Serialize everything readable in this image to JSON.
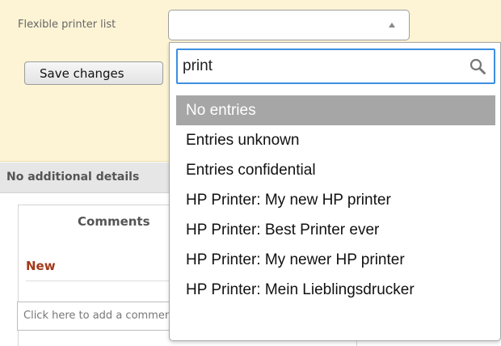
{
  "form": {
    "field_label": "Flexible printer list",
    "selected_value": "",
    "save_label": "Save changes"
  },
  "section": {
    "title": "No additional details"
  },
  "comments": {
    "title": "Comments",
    "new_label": "New",
    "input_text": "Click here to add a comment"
  },
  "dropdown": {
    "search_value": "print",
    "options": [
      {
        "label": "No entries",
        "highlighted": true
      },
      {
        "label": "Entries unknown",
        "highlighted": false
      },
      {
        "label": "Entries confidential",
        "highlighted": false
      },
      {
        "label": "HP Printer: My new HP printer",
        "highlighted": false
      },
      {
        "label": "HP Printer: Best Printer ever",
        "highlighted": false
      },
      {
        "label": "HP Printer: My newer HP printer",
        "highlighted": false
      },
      {
        "label": "HP Printer: Mein Lieblingsdrucker",
        "highlighted": false
      }
    ]
  },
  "colors": {
    "panel_bg": "#fdf4d5",
    "highlight": "#a6a6a6",
    "focus_border": "#3d8fe0",
    "new_label": "#a33a1a"
  }
}
